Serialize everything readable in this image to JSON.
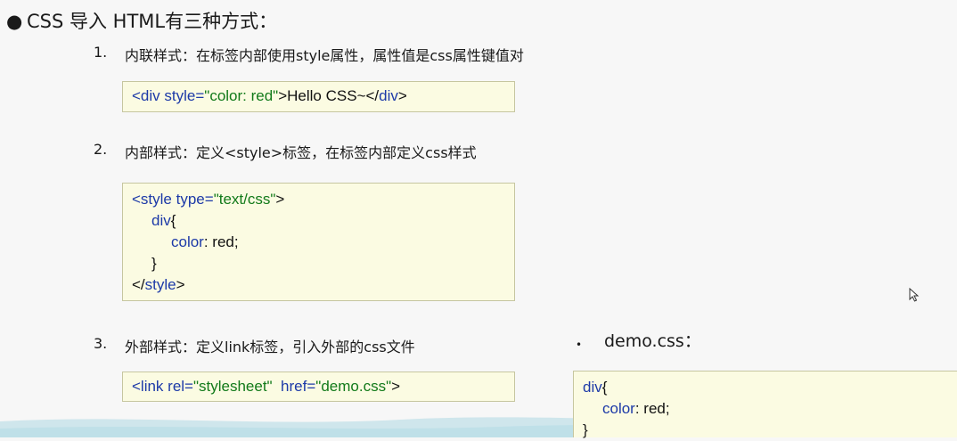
{
  "heading": {
    "bullet": "●",
    "text": "CSS 导入 HTML有三种方式："
  },
  "items": [
    {
      "num": "1.",
      "text": "内联样式：在标签内部使用style属性，属性值是css属性键值对",
      "code": [
        "<div",
        " style=",
        "\"color:",
        " red\"",
        ">Hello CSS~</",
        "div",
        ">"
      ]
    },
    {
      "num": "2.",
      "text": "内部样式：定义<style>标签，在标签内部定义css样式",
      "code": {
        "l1a": "<style",
        "l1b": " type=",
        "l1c": "\"text/css\"",
        "l1d": ">",
        "l2": "div",
        "l2b": "{",
        "l3a": "color",
        "l3b": ": red;",
        "l4": "}",
        "l5a": "</",
        "l5b": "style",
        "l5c": ">"
      }
    },
    {
      "num": "3.",
      "text": "外部样式：定义link标签，引入外部的css文件",
      "code": {
        "a": "<link",
        "b": " rel=",
        "c": "\"stylesheet\"",
        "d": "  href=",
        "e": "\"demo.css\"",
        "f": ">"
      }
    }
  ],
  "demo": {
    "bullet": "•",
    "label": "demo.css：",
    "l1a": "div",
    "l1b": "{",
    "l2a": "color",
    "l2b": ": red;",
    "l3": "}"
  },
  "icons": {
    "cursor": "mouse-pointer-icon"
  }
}
